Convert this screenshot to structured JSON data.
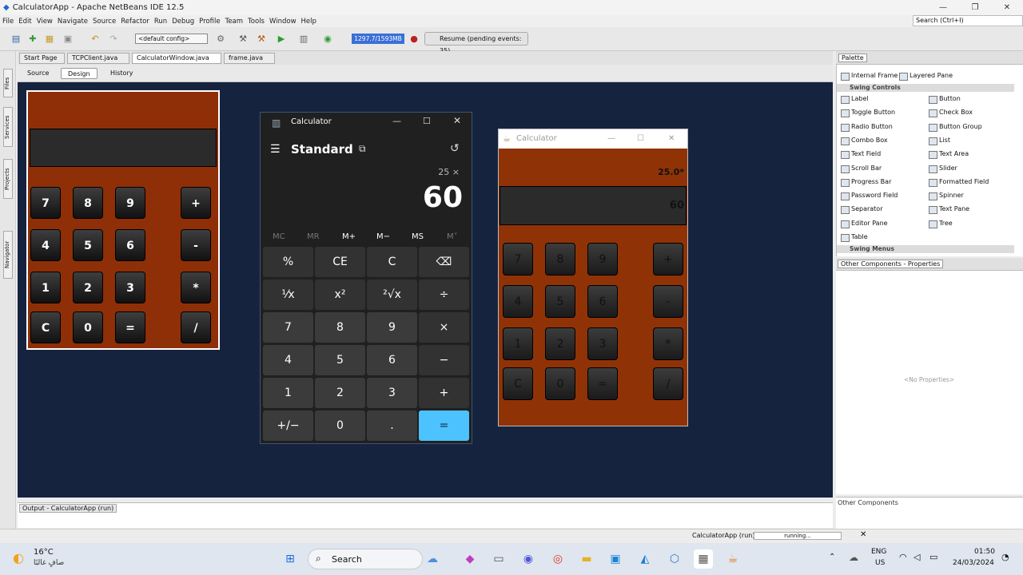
{
  "window": {
    "title": "CalculatorApp - Apache NetBeans IDE 12.5",
    "min": "—",
    "max": "❐",
    "close": "✕"
  },
  "menu": [
    "File",
    "Edit",
    "View",
    "Navigate",
    "Source",
    "Refactor",
    "Run",
    "Debug",
    "Profile",
    "Team",
    "Tools",
    "Window",
    "Help"
  ],
  "search_placeholder": "Search (Ctrl+I)",
  "toolbar": {
    "config": "<default config>",
    "memory": "1297.7/1593MB",
    "resume": "Resume (pending events: 35)"
  },
  "left_tabs": [
    "Files",
    "Services",
    "Projects",
    "Navigator"
  ],
  "editor_tabs": [
    "Start Page",
    "TCPClient.java",
    "CalculatorWindow.java",
    "frame.java"
  ],
  "view_tabs": [
    "Source",
    "Design",
    "History"
  ],
  "design_calc": {
    "buttons": [
      [
        "7",
        "8",
        "9",
        "+"
      ],
      [
        "4",
        "5",
        "6",
        "-"
      ],
      [
        "1",
        "2",
        "3",
        "*"
      ],
      [
        "C",
        "0",
        "=",
        "/"
      ]
    ]
  },
  "win_calc": {
    "title": "Calculator",
    "mode": "Standard",
    "expression": "25 ×",
    "display": "60",
    "memory": [
      "MC",
      "MR",
      "M+",
      "M−",
      "MS",
      "M˅"
    ],
    "keys": [
      [
        "%",
        "CE",
        "C",
        "⌫"
      ],
      [
        "¹⁄x",
        "x²",
        "²√x",
        "÷"
      ],
      [
        "7",
        "8",
        "9",
        "×"
      ],
      [
        "4",
        "5",
        "6",
        "−"
      ],
      [
        "1",
        "2",
        "3",
        "+"
      ],
      [
        "+/−",
        "0",
        ".",
        "="
      ]
    ]
  },
  "run_calc": {
    "title": "Calculator",
    "expression": "25.0*",
    "display": "60",
    "buttons": [
      [
        "7",
        "8",
        "9",
        "+"
      ],
      [
        "4",
        "5",
        "6",
        "-"
      ],
      [
        "1",
        "2",
        "3",
        "*"
      ],
      [
        "C",
        "0",
        "=",
        "/"
      ]
    ]
  },
  "palette": {
    "title": "Palette",
    "top": [
      {
        "label": "Internal Frame"
      },
      {
        "label": "Layered Pane"
      }
    ],
    "group_controls": "Swing Controls",
    "controls": [
      "Label",
      "Button",
      "Toggle Button",
      "Check Box",
      "Radio Button",
      "Button Group",
      "Combo Box",
      "List",
      "Text Field",
      "Text Area",
      "Scroll Bar",
      "Slider",
      "Progress Bar",
      "Formatted Field",
      "Password Field",
      "Spinner",
      "Separator",
      "Text Pane",
      "Editor Pane",
      "Tree",
      "Table"
    ],
    "group_menus": "Swing Menus"
  },
  "properties": {
    "title": "Other Components - Properties",
    "empty": "<No Properties>",
    "other": "Other Components"
  },
  "output": {
    "title": "Output - CalculatorApp (run)"
  },
  "status": {
    "app": "CalculatorApp (run)",
    "state": "running..."
  },
  "taskbar": {
    "temp": "16°C",
    "weather": "صافٍ غالبًا",
    "search": "Search",
    "lang1": "ENG",
    "lang2": "US",
    "time": "01:50",
    "date": "24/03/2024"
  }
}
